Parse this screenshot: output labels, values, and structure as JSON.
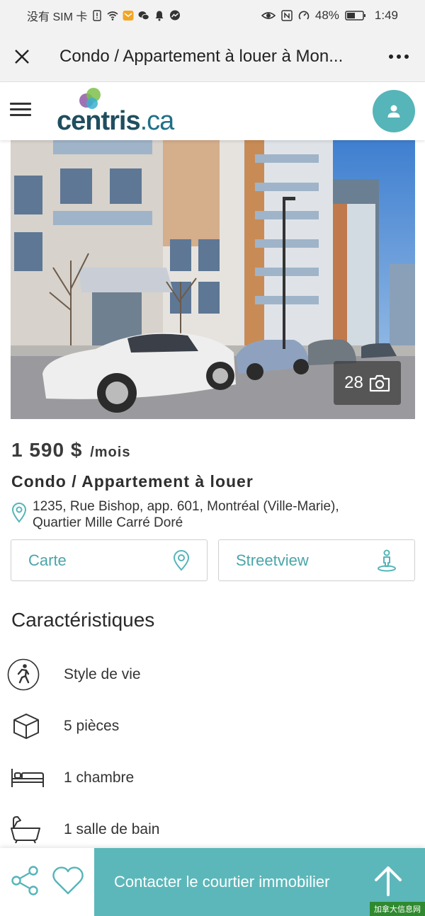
{
  "status_bar": {
    "carrier": "没有 SIM 卡",
    "battery": "48%",
    "time": "1:49"
  },
  "title_bar": {
    "title": "Condo / Appartement à louer à Mon..."
  },
  "header": {
    "logo_main": "centris",
    "logo_tld": ".ca"
  },
  "photo": {
    "count": "28"
  },
  "listing": {
    "price": "1 590 $",
    "price_unit": "/mois",
    "type": "Condo / Appartement à louer",
    "address_line1": "1235, Rue Bishop, app. 601, Montréal (Ville-Marie),",
    "address_line2": "Quartier Mille Carré Doré",
    "map_button": "Carte",
    "streetview_button": "Streetview"
  },
  "features": {
    "title": "Caractéristiques",
    "items": [
      {
        "label": "Style de vie",
        "icon": "walking-person-icon"
      },
      {
        "label": "5 pièces",
        "icon": "cube-icon"
      },
      {
        "label": "1 chambre",
        "icon": "bed-icon"
      },
      {
        "label": "1 salle de bain",
        "icon": "bathtub-icon"
      }
    ]
  },
  "bottom_bar": {
    "contact": "Contacter le courtier immobilier"
  },
  "watermark": "加拿大信息网",
  "colors": {
    "accent": "#5cb7ba",
    "accent_text": "#4aa5a9",
    "logo_dark": "#1f4e5f"
  }
}
